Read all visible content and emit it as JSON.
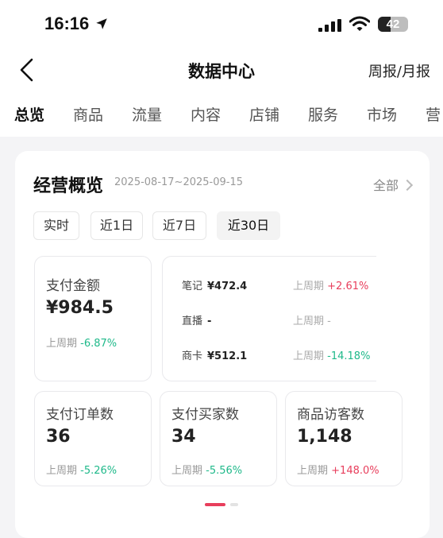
{
  "status_bar": {
    "time": "16:16",
    "battery": "42",
    "battery_level": 0.42
  },
  "nav": {
    "title": "数据中心",
    "right_link": "周报/月报"
  },
  "tabs": [
    "总览",
    "商品",
    "流量",
    "内容",
    "店铺",
    "服务",
    "市场",
    "营"
  ],
  "overview": {
    "title": "经营概览",
    "date_range": "2025-08-17~2025-09-15",
    "all_link": "全部",
    "filters": [
      "实时",
      "近1日",
      "近7日",
      "近30日"
    ],
    "active_filter": "近30日",
    "pay_amount": {
      "label": "支付金额",
      "value": "¥984.5",
      "cmp_label": "上周期",
      "cmp_value": "-6.87%"
    },
    "breakdown": [
      {
        "name": "笔记",
        "value": "¥472.4",
        "cmp_label": "上周期",
        "cmp_value": "+2.61%"
      },
      {
        "name": "直播",
        "value": "-",
        "cmp_label": "上周期",
        "cmp_value": "-"
      },
      {
        "name": "商卡",
        "value": "¥512.1",
        "cmp_label": "上周期",
        "cmp_value": "-14.18%"
      }
    ],
    "metrics": [
      {
        "label": "支付订单数",
        "value": "36",
        "cmp_label": "上周期",
        "cmp_value": "-5.26%"
      },
      {
        "label": "支付买家数",
        "value": "34",
        "cmp_label": "上周期",
        "cmp_value": "-5.56%"
      },
      {
        "label": "商品访客数",
        "value": "1,148",
        "cmp_label": "上周期",
        "cmp_value": "+148.0%"
      }
    ]
  },
  "colors": {
    "accent": "#e83e5c",
    "negative": "#1fb98a",
    "background": "#f4f4f6"
  },
  "icons": [
    "location-arrow-icon",
    "signal-icon",
    "wifi-icon",
    "battery-icon",
    "back-chevron-icon",
    "chevron-right-icon"
  ]
}
